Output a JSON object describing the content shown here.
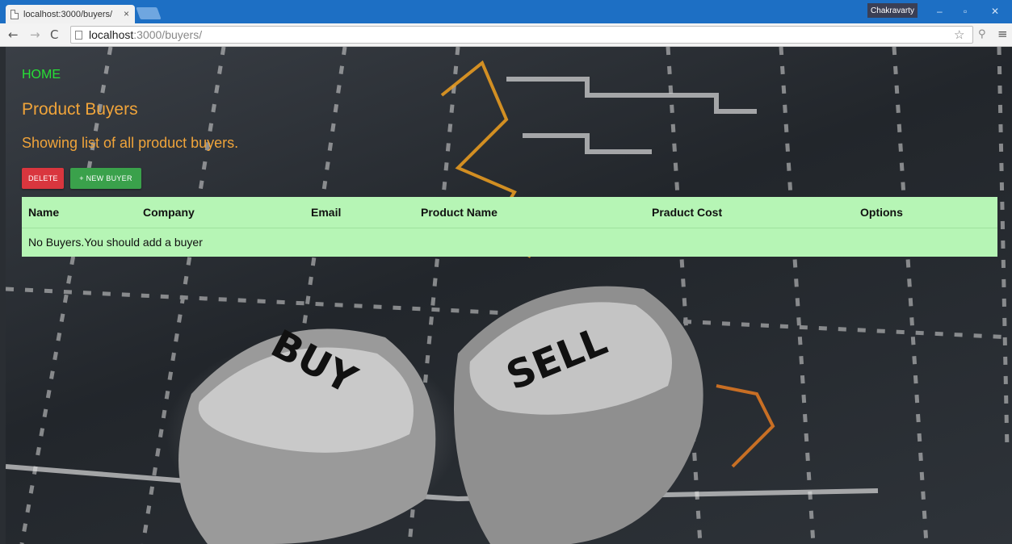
{
  "browser": {
    "tab_title": "localhost:3000/buyers/",
    "tab_close": "×",
    "profile_name": "Chakravarty",
    "url_host": "localhost",
    "url_path": ":3000/buyers/",
    "icons": {
      "back": "back-arrow-icon",
      "forward": "forward-arrow-icon",
      "reload": "reload-icon",
      "bookmark": "star-icon",
      "extension": "extension-icon",
      "menu": "hamburger-menu-icon"
    }
  },
  "page": {
    "home_link": "HOME",
    "title": "Product Buyers",
    "subtitle": "Showing list of all product buyers.",
    "buttons": {
      "delete": "DELETE",
      "new_buyer": "+ NEW BUYER"
    },
    "table": {
      "columns": [
        "Name",
        "Company",
        "Email",
        "Product Name",
        "Praduct Cost",
        "Options"
      ],
      "empty_message": "No Buyers.You should add a buyer"
    },
    "background": {
      "dice_left_text": "BUY",
      "dice_right_text": "SELL"
    },
    "colors": {
      "accent_orange": "#f0a43a",
      "home_green": "#27e036",
      "table_bg": "#b6f5b5",
      "delete_red": "#d9363e",
      "new_green": "#3aa14b",
      "chrome_blue": "#1d6fc4"
    }
  }
}
